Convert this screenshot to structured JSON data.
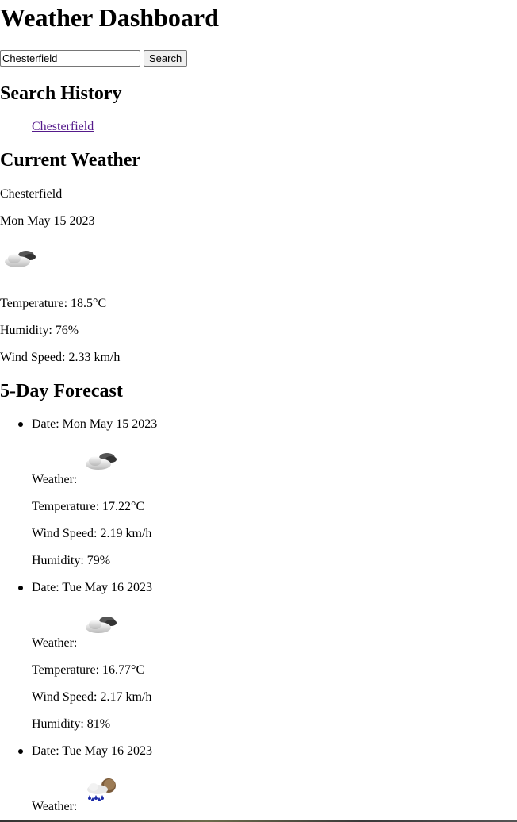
{
  "title": "Weather Dashboard",
  "search": {
    "value": "Chesterfield",
    "placeholder": "",
    "button_label": "Search"
  },
  "history": {
    "heading": "Search History",
    "items": [
      "Chesterfield"
    ]
  },
  "current": {
    "heading": "Current Weather",
    "city": "Chesterfield",
    "date": "Mon May 15 2023",
    "icon": "partly-cloudy-icon",
    "temperature": "Temperature: 18.5°C",
    "humidity": "Humidity: 76%",
    "wind": "Wind Speed: 2.33 km/h"
  },
  "forecast": {
    "heading": "5-Day Forecast",
    "weather_label": "Weather:",
    "days": [
      {
        "date": "Date: Mon May 15 2023",
        "icon": "partly-cloudy-icon",
        "temperature": "Temperature: 17.22°C",
        "wind": "Wind Speed: 2.19 km/h",
        "humidity": "Humidity: 79%"
      },
      {
        "date": "Date: Tue May 16 2023",
        "icon": "partly-cloudy-icon",
        "temperature": "Temperature: 16.77°C",
        "wind": "Wind Speed: 2.17 km/h",
        "humidity": "Humidity: 81%"
      },
      {
        "date": "Date: Tue May 16 2023",
        "icon": "rain-icon"
      }
    ]
  }
}
